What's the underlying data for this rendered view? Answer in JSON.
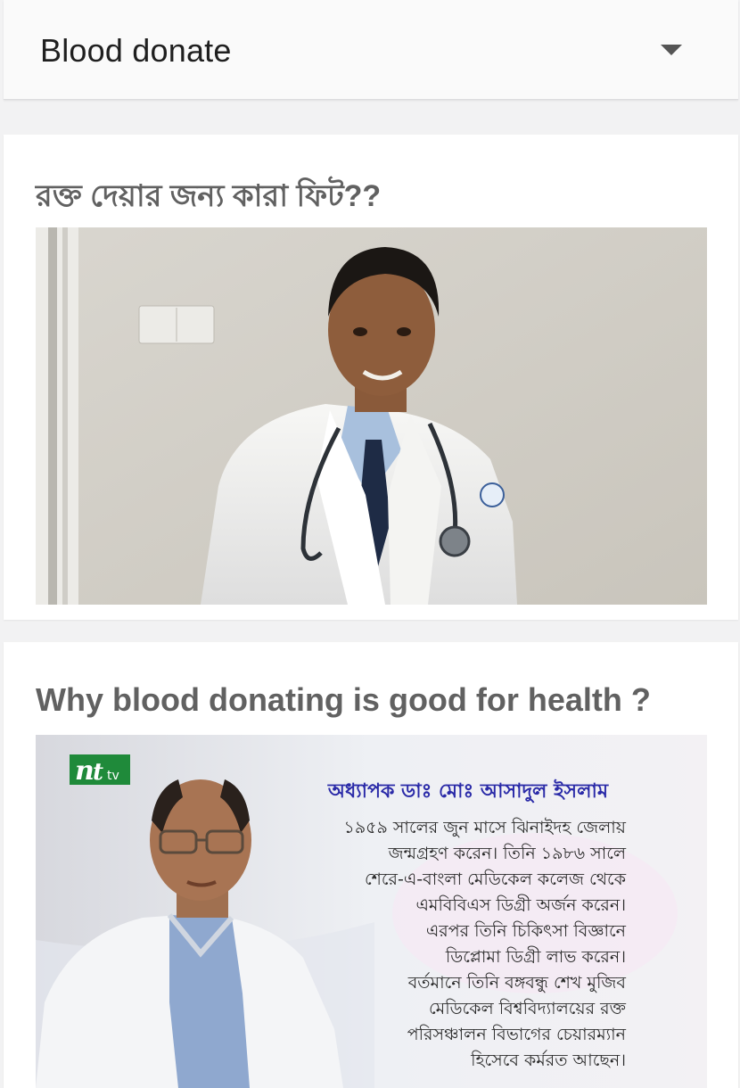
{
  "dropdown": {
    "selected": "Blood donate",
    "caret_icon": "caret-down-icon"
  },
  "videos": [
    {
      "title": "রক্ত দেয়ার জন্য কারা ফিট??",
      "thumbnail": "doctor-in-white-coat-thumbnail"
    },
    {
      "title": "Why blood donating is good for health ?",
      "thumbnail": "ntv-interview-thumbnail",
      "channel_logo": "ntv",
      "overlay_heading": "অধ্যাপক ডাঃ মোঃ আসাদুল ইসলাম",
      "overlay_lines": [
        "১৯৫৯ সালের জুন মাসে ঝিনাইদহ জেলায়",
        "জন্মগ্রহণ করেন। তিনি ১৯৮৬ সালে",
        "শেরে-এ-বাংলা মেডিকেল কলেজ থেকে",
        "এমবিবিএস ডিগ্রী অর্জন করেন।",
        "এরপর তিনি চিকিৎসা বিজ্ঞানে",
        "ডিপ্লোমা ডিগ্রী লাভ করেন।",
        "বর্তমানে তিনি বঙ্গবন্ধু শেখ মুজিব",
        "মেডিকেল বিশ্ববিদ্যালয়ের রক্ত",
        "পরিসঞ্চালন বিভাগের চেয়ারম্যান",
        "হিসেবে কর্মরত আছেন।"
      ]
    }
  ]
}
